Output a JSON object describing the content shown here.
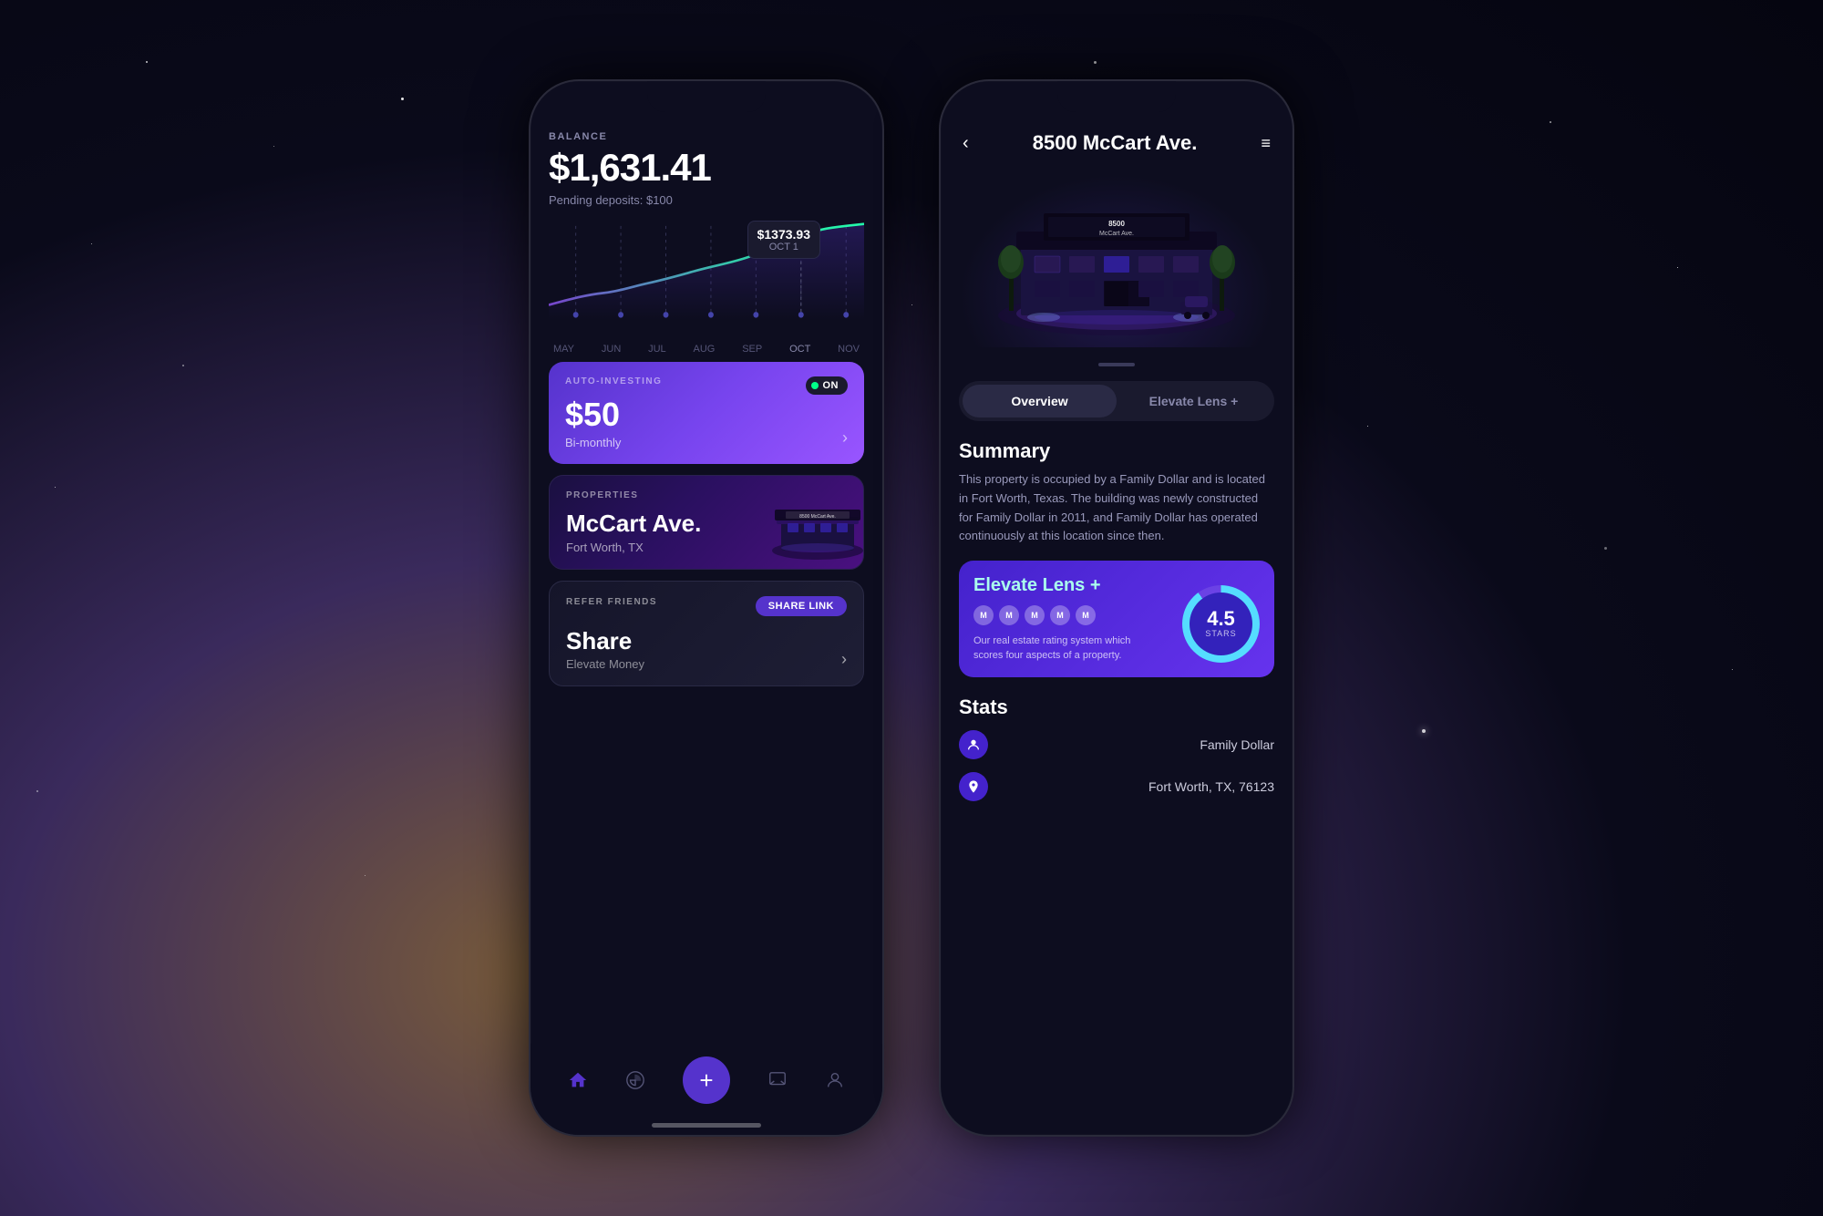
{
  "background": {
    "gradient": "space"
  },
  "left_phone": {
    "balance": {
      "label": "BALANCE",
      "amount": "$1,631.41",
      "pending": "Pending deposits: $100"
    },
    "chart": {
      "tooltip_amount": "$1373.93",
      "tooltip_date": "OCT 1",
      "months": [
        "MAY",
        "JUN",
        "JUL",
        "AUG",
        "SEP",
        "OCT",
        "NOV"
      ]
    },
    "auto_investing": {
      "label": "AUTO-INVESTING",
      "toggle_text": "ON",
      "amount": "$50",
      "frequency": "Bi-monthly"
    },
    "properties": {
      "label": "PROPERTIES",
      "name": "McCart Ave.",
      "location": "Fort Worth, TX"
    },
    "refer": {
      "label": "REFER FRIENDS",
      "share_button": "SHARE LINK",
      "title": "Share",
      "subtitle": "Elevate Money"
    },
    "nav": {
      "items": [
        "home",
        "chart",
        "add",
        "message",
        "profile"
      ]
    }
  },
  "right_phone": {
    "header": {
      "title": "8500 McCart Ave.",
      "back": "‹",
      "menu": "≡"
    },
    "tabs": [
      {
        "label": "Overview",
        "active": true
      },
      {
        "label": "Elevate Lens +",
        "active": false
      }
    ],
    "summary": {
      "title": "Summary",
      "text": "This property is occupied by a Family Dollar and is located in Fort Worth, Texas. The building was newly constructed for Family Dollar in 2011, and Family Dollar has operated continuously at this location since then."
    },
    "elevate_lens": {
      "title": "Elevate Lens",
      "plus": "+",
      "dots": [
        "M",
        "M",
        "M",
        "M",
        "M"
      ],
      "description": "Our real estate rating system which scores four aspects of a property.",
      "rating": "4.5",
      "rating_label": "STARS"
    },
    "stats": {
      "title": "Stats",
      "rows": [
        {
          "icon": "person",
          "value": "Family Dollar"
        },
        {
          "icon": "location",
          "value": "Fort Worth, TX, 76123"
        }
      ]
    }
  }
}
